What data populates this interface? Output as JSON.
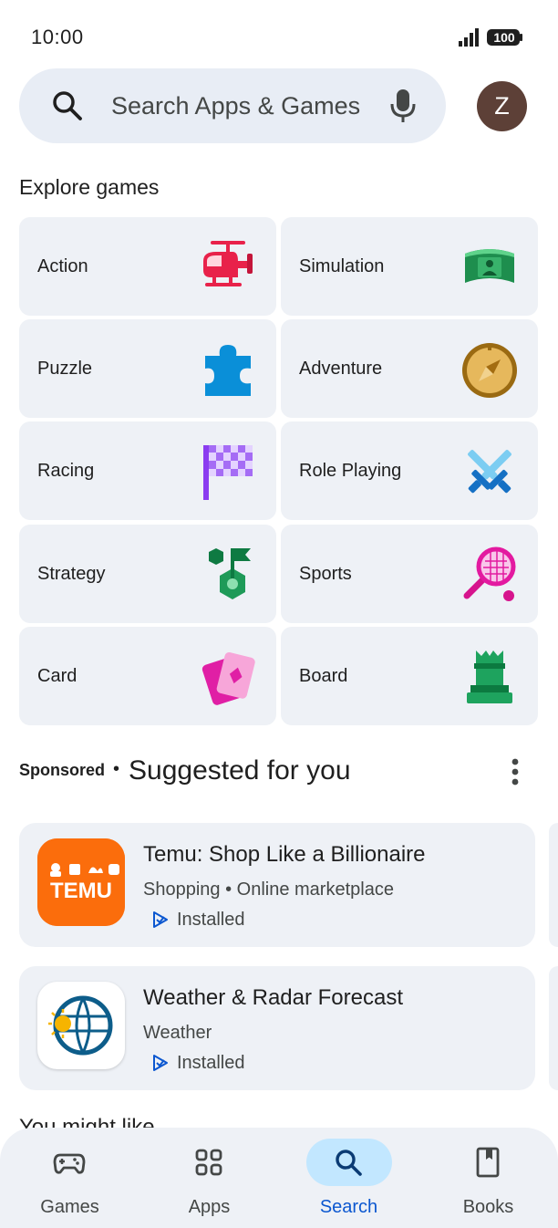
{
  "status_bar": {
    "time": "10:00",
    "battery": "100",
    "icons": [
      "signal-icon",
      "battery-icon"
    ]
  },
  "search": {
    "placeholder": "Search Apps & Games",
    "icons": [
      "search-icon",
      "mic-icon"
    ]
  },
  "account": {
    "avatar_letter": "Z",
    "avatar_color": "#5d4037"
  },
  "explore": {
    "title": "Explore games",
    "genres": [
      {
        "label": "Action",
        "icon": "helicopter-icon"
      },
      {
        "label": "Simulation",
        "icon": "simulation-icon"
      },
      {
        "label": "Puzzle",
        "icon": "puzzle-piece-icon"
      },
      {
        "label": "Adventure",
        "icon": "compass-icon"
      },
      {
        "label": "Racing",
        "icon": "checkered-flag-icon"
      },
      {
        "label": "Role Playing",
        "icon": "crossed-swords-icon"
      },
      {
        "label": "Strategy",
        "icon": "strategy-flag-icon"
      },
      {
        "label": "Sports",
        "icon": "tennis-racket-icon"
      },
      {
        "label": "Card",
        "icon": "playing-cards-icon"
      },
      {
        "label": "Board",
        "icon": "chess-rook-icon"
      }
    ]
  },
  "suggested": {
    "sponsored": "Sponsored",
    "separator": "•",
    "title": "Suggested for you",
    "apps": [
      {
        "name": "Temu: Shop Like a Billionaire",
        "category": "Shopping • Online marketplace",
        "status": "Installed",
        "icon": "temu-app-icon",
        "icon_text": "TEMU"
      },
      {
        "name": "Weather & Radar Forecast",
        "category": "Weather",
        "status": "Installed",
        "icon": "weather-radar-app-icon"
      }
    ]
  },
  "next_section": {
    "title": "You might like"
  },
  "bottom_nav": {
    "items": [
      {
        "label": "Games",
        "icon": "gamepad-icon",
        "active": false
      },
      {
        "label": "Apps",
        "icon": "apps-grid-icon",
        "active": false
      },
      {
        "label": "Search",
        "icon": "search-icon",
        "active": true
      },
      {
        "label": "Books",
        "icon": "book-icon",
        "active": false
      }
    ]
  },
  "colors": {
    "accent": "#0b57d0",
    "active_pill": "#c2e7ff",
    "surface": "#eef1f6",
    "search_surface": "#e8edf5"
  }
}
